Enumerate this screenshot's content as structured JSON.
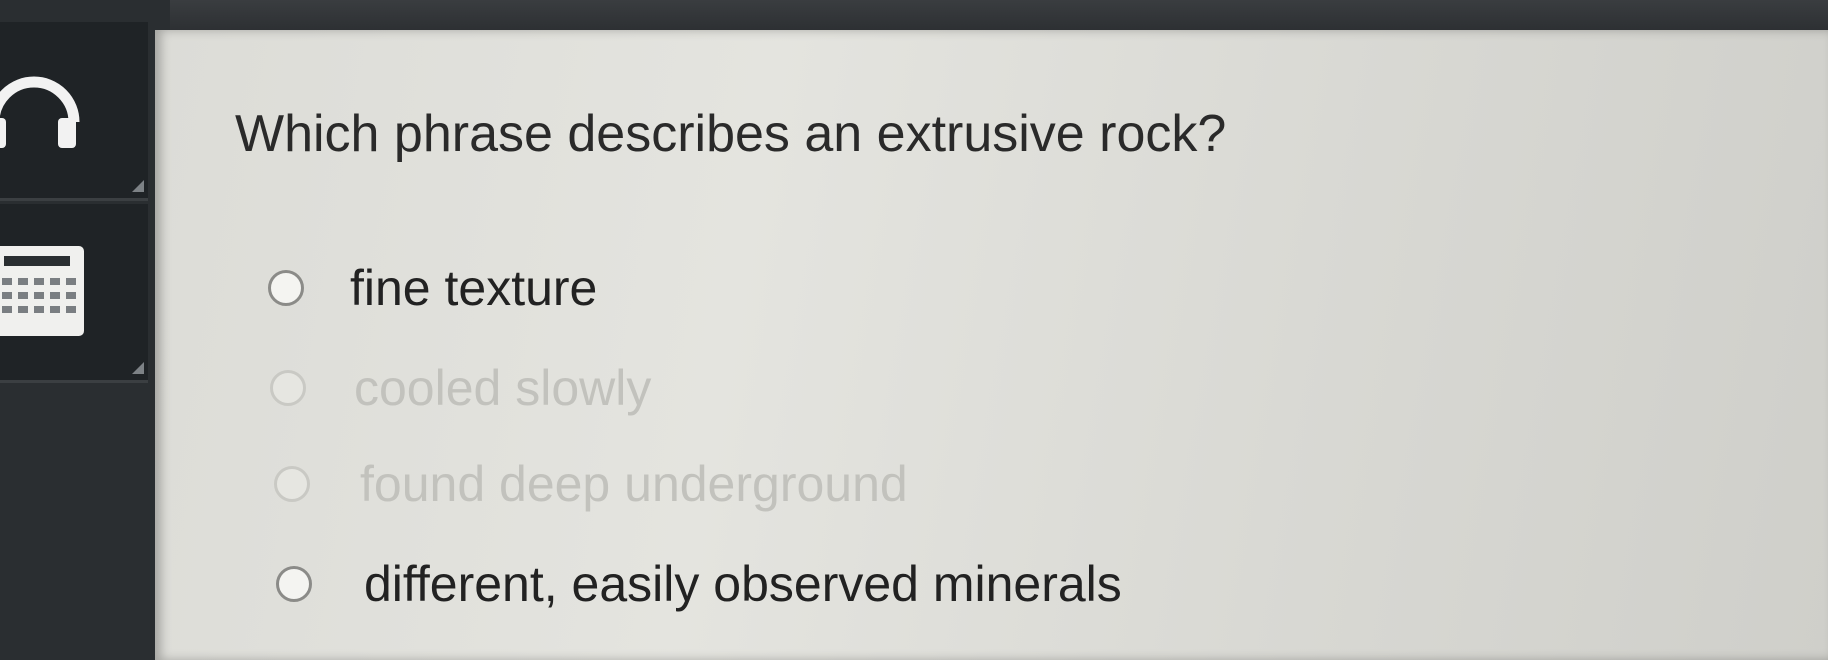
{
  "sidebar": {
    "tools": [
      {
        "name": "headphones",
        "icon": "headphones-icon"
      },
      {
        "name": "calculator",
        "icon": "calculator-icon"
      }
    ]
  },
  "question": {
    "text": "Which phrase describes an extrusive rock?"
  },
  "options": [
    {
      "label": "fine texture"
    },
    {
      "label": "cooled slowly"
    },
    {
      "label": "found deep underground"
    },
    {
      "label": "different, easily observed minerals"
    }
  ],
  "colors": {
    "panel_background": "#e0e0db",
    "sidebar_background": "#2a2e31",
    "text": "#222222",
    "faded_text": "#c2c2bd"
  }
}
